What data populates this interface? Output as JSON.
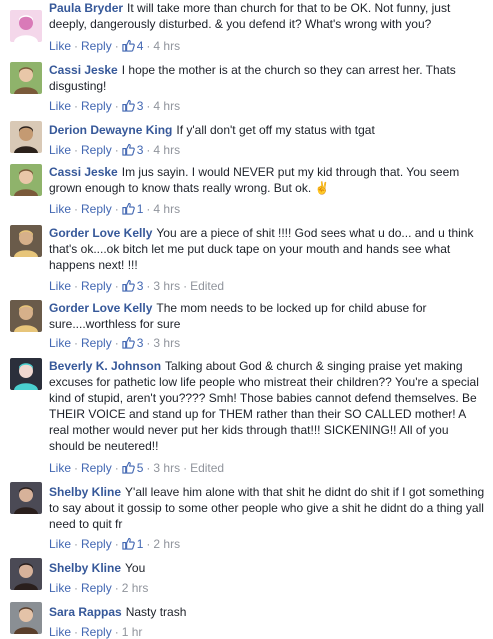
{
  "comments": [
    {
      "name": "Paula Bryder",
      "text": "It will take more than church for that to be OK. Not funny, just deeply, dangerously disturbed. & you defend it? What's wrong with you?",
      "like_label": "Like",
      "reply_label": "Reply",
      "likes": "4",
      "time": "4 hrs",
      "edited": ""
    },
    {
      "name": "Cassi Jeske",
      "text": "I hope the mother is at the church so they can arrest her. Thats disgusting!",
      "like_label": "Like",
      "reply_label": "Reply",
      "likes": "3",
      "time": "4 hrs",
      "edited": ""
    },
    {
      "name": "Derion Dewayne King",
      "text": "If y'all don't get off my status with tgat",
      "like_label": "Like",
      "reply_label": "Reply",
      "likes": "3",
      "time": "4 hrs",
      "edited": ""
    },
    {
      "name": "Cassi Jeske",
      "text": "Im jus sayin. I would NEVER put my kid through that. You seem grown enough to know thats really wrong. But ok. ✌",
      "like_label": "Like",
      "reply_label": "Reply",
      "likes": "1",
      "time": "4 hrs",
      "edited": ""
    },
    {
      "name": "Gorder Love Kelly",
      "text": "You are a piece of shit !!!! God sees what u do... and u think that's ok....ok bitch let me put duck tape on your mouth and hands see what happens next! !!!",
      "like_label": "Like",
      "reply_label": "Reply",
      "likes": "3",
      "time": "3 hrs",
      "edited": "Edited"
    },
    {
      "name": "Gorder Love Kelly",
      "text": "The mom needs to be locked up for child abuse for sure....worthless for sure",
      "like_label": "Like",
      "reply_label": "Reply",
      "likes": "3",
      "time": "3 hrs",
      "edited": ""
    },
    {
      "name": "Beverly K. Johnson",
      "text": "Talking about God & church & singing praise yet making excuses for pathetic low life people who mistreat their children?? You're a special kind of stupid, aren't you???? Smh! Those babies cannot defend themselves. Be THEIR VOICE and stand up for THEM rather than their SO CALLED mother! A real mother would never put her kids through that!!! SICKENING!! All of you should be neutered!!",
      "like_label": "Like",
      "reply_label": "Reply",
      "likes": "5",
      "time": "3 hrs",
      "edited": "Edited"
    },
    {
      "name": "Shelby Kline",
      "text": "Y'all leave him alone with that shit he didnt do shit if I got something to say about it gossip to some other people who give a shit he didnt do a thing yall need to quit fr",
      "like_label": "Like",
      "reply_label": "Reply",
      "likes": "1",
      "time": "2 hrs",
      "edited": ""
    },
    {
      "name": "Shelby Kline",
      "text": "You",
      "like_label": "Like",
      "reply_label": "Reply",
      "likes": "",
      "time": "2 hrs",
      "edited": ""
    },
    {
      "name": "Sara Rappas",
      "text": "Nasty trash",
      "like_label": "Like",
      "reply_label": "Reply",
      "likes": "",
      "time": "1 hr",
      "edited": ""
    }
  ],
  "colors": {
    "name_link": "#365899",
    "action_link": "#4267b2",
    "meta_gray": "#90949c",
    "body_text": "#1d2129"
  },
  "icons": {
    "reaction": "thumbs-up-icon"
  }
}
